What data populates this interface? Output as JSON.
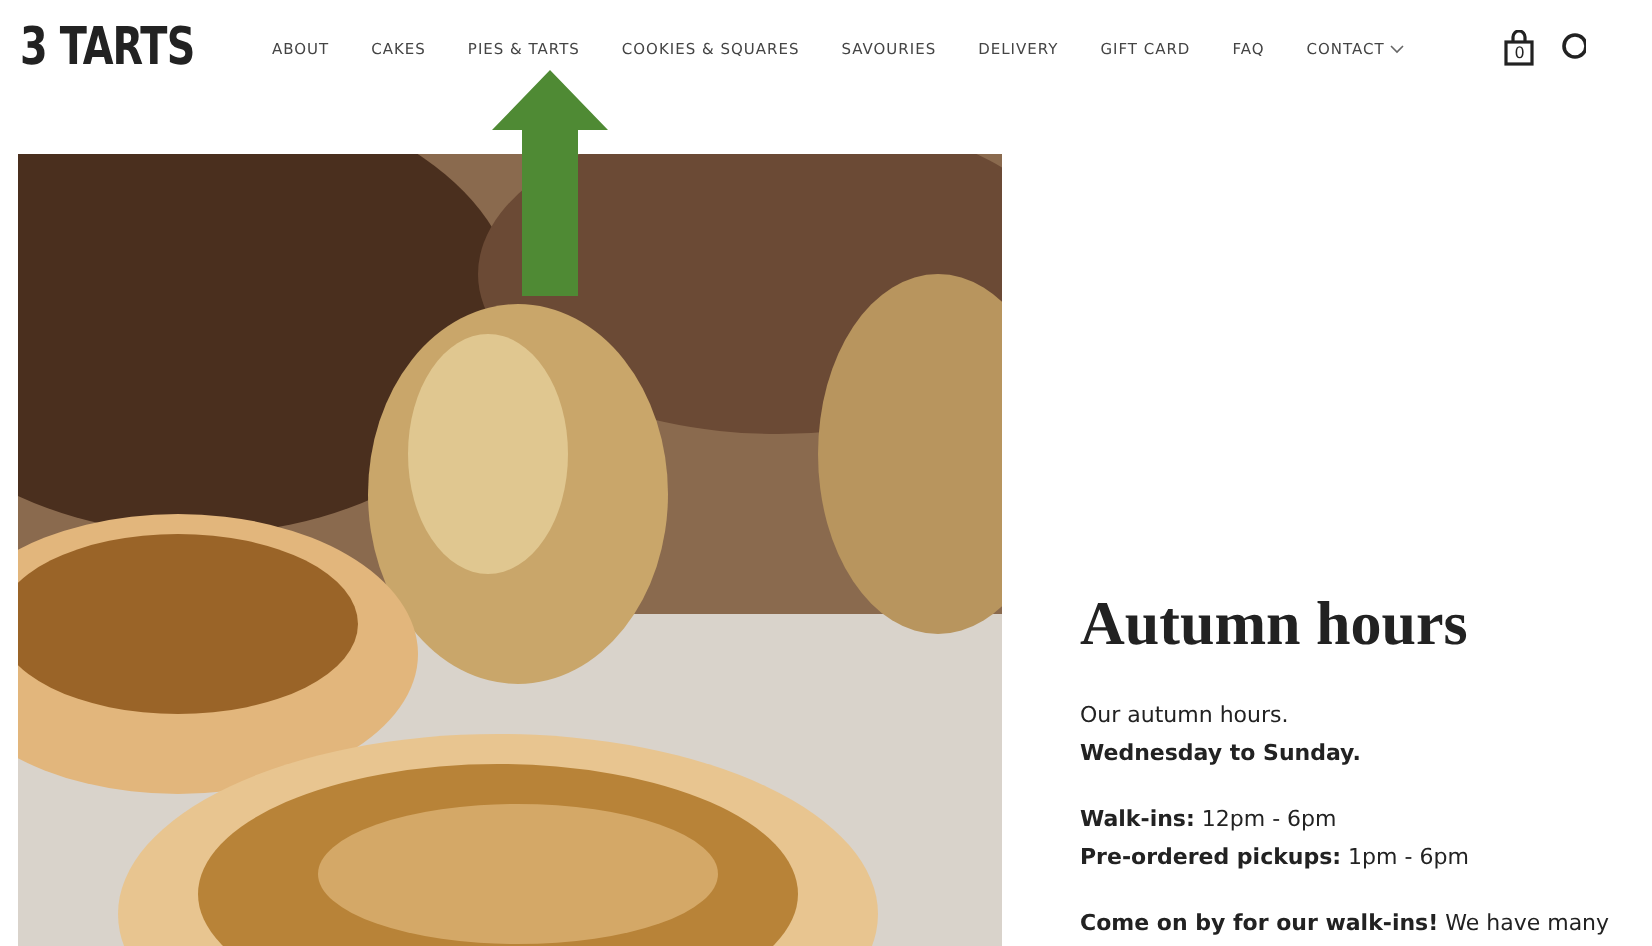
{
  "logo": "3 TARTS",
  "nav": [
    {
      "label": "ABOUT",
      "dropdown": false
    },
    {
      "label": "CAKES",
      "dropdown": false
    },
    {
      "label": "PIES & TARTS",
      "dropdown": false
    },
    {
      "label": "COOKIES & SQUARES",
      "dropdown": false
    },
    {
      "label": "SAVOURIES",
      "dropdown": false
    },
    {
      "label": "DELIVERY",
      "dropdown": false
    },
    {
      "label": "GIFT CARD",
      "dropdown": false
    },
    {
      "label": "FAQ",
      "dropdown": false
    },
    {
      "label": "CONTACT",
      "dropdown": true
    }
  ],
  "cart_count": "0",
  "content": {
    "heading": "Autumn hours",
    "paragraphs": [
      [
        "Our autumn hours.",
        "**Wednesday to Sunday.**"
      ],
      [
        "**Walk-ins:** 12pm - 6pm",
        "**Pre-ordered pickups:** 1pm - 6pm"
      ],
      [
        "**Come on by for our walk-ins!** We have many"
      ]
    ]
  }
}
